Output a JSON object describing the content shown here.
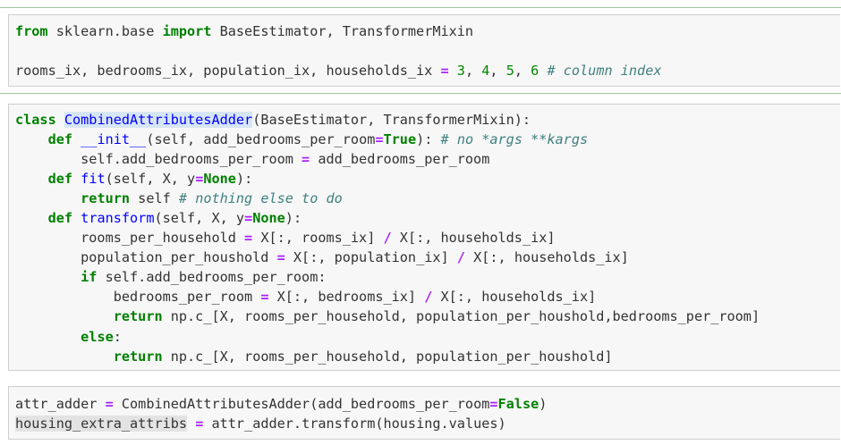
{
  "cells": [
    {
      "lines": [
        [
          {
            "t": "from",
            "c": "kw"
          },
          {
            "t": " sklearn.base "
          },
          {
            "t": "import",
            "c": "kw"
          },
          {
            "t": " BaseEstimator, TransformerMixin"
          }
        ],
        [],
        [
          {
            "t": "rooms_ix, bedrooms_ix, population_ix, households_ix "
          },
          {
            "t": "=",
            "c": "op"
          },
          {
            "t": " "
          },
          {
            "t": "3",
            "c": "num"
          },
          {
            "t": ", "
          },
          {
            "t": "4",
            "c": "num"
          },
          {
            "t": ", "
          },
          {
            "t": "5",
            "c": "num"
          },
          {
            "t": ", "
          },
          {
            "t": "6",
            "c": "num"
          },
          {
            "t": " "
          },
          {
            "t": "# column index",
            "c": "cm"
          }
        ]
      ]
    },
    {
      "lines": [
        [
          {
            "t": "class",
            "c": "kw"
          },
          {
            "t": " "
          },
          {
            "t": "CombinedAttributesAdder",
            "c": "cls"
          },
          {
            "t": "(BaseEstimator, TransformerMixin):"
          }
        ],
        [
          {
            "t": "    "
          },
          {
            "t": "def",
            "c": "kw"
          },
          {
            "t": " "
          },
          {
            "t": "__init__",
            "c": "fn"
          },
          {
            "t": "(self, add_bedrooms_per_room"
          },
          {
            "t": "=",
            "c": "op"
          },
          {
            "t": "True",
            "c": "kw"
          },
          {
            "t": "): "
          },
          {
            "t": "# no *args **kargs",
            "c": "cm"
          }
        ],
        [
          {
            "t": "        self.add_bedrooms_per_room "
          },
          {
            "t": "=",
            "c": "op"
          },
          {
            "t": " add_bedrooms_per_room"
          }
        ],
        [
          {
            "t": "    "
          },
          {
            "t": "def",
            "c": "kw"
          },
          {
            "t": " "
          },
          {
            "t": "fit",
            "c": "fn"
          },
          {
            "t": "(self, X, y"
          },
          {
            "t": "=",
            "c": "op"
          },
          {
            "t": "None",
            "c": "kw"
          },
          {
            "t": "):"
          }
        ],
        [
          {
            "t": "        "
          },
          {
            "t": "return",
            "c": "kw"
          },
          {
            "t": " self "
          },
          {
            "t": "# nothing else to do",
            "c": "cm"
          }
        ],
        [
          {
            "t": "    "
          },
          {
            "t": "def",
            "c": "kw"
          },
          {
            "t": " "
          },
          {
            "t": "transform",
            "c": "fn"
          },
          {
            "t": "(self, X, y"
          },
          {
            "t": "=",
            "c": "op"
          },
          {
            "t": "None",
            "c": "kw"
          },
          {
            "t": "):"
          }
        ],
        [
          {
            "t": "        rooms_per_household "
          },
          {
            "t": "=",
            "c": "op"
          },
          {
            "t": " X[:, rooms_ix] "
          },
          {
            "t": "/",
            "c": "op"
          },
          {
            "t": " X[:, households_ix]"
          }
        ],
        [
          {
            "t": "        population_per_houshold "
          },
          {
            "t": "=",
            "c": "op"
          },
          {
            "t": " X[:, population_ix] "
          },
          {
            "t": "/",
            "c": "op"
          },
          {
            "t": " X[:, households_ix]"
          }
        ],
        [
          {
            "t": "        "
          },
          {
            "t": "if",
            "c": "kw"
          },
          {
            "t": " self.add_bedrooms_per_room:"
          }
        ],
        [
          {
            "t": "            bedrooms_per_room "
          },
          {
            "t": "=",
            "c": "op"
          },
          {
            "t": " X[:, bedrooms_ix] "
          },
          {
            "t": "/",
            "c": "op"
          },
          {
            "t": " X[:, households_ix]"
          }
        ],
        [
          {
            "t": "            "
          },
          {
            "t": "return",
            "c": "kw"
          },
          {
            "t": " np.c_[X, rooms_per_household, population_per_houshold,bedrooms_per_room]"
          }
        ],
        [
          {
            "t": "        "
          },
          {
            "t": "else",
            "c": "kw"
          },
          {
            "t": ":"
          }
        ],
        [
          {
            "t": "            "
          },
          {
            "t": "return",
            "c": "kw"
          },
          {
            "t": " np.c_[X, rooms_per_household, population_per_houshold]"
          }
        ]
      ]
    },
    {
      "lines": [
        [
          {
            "t": "attr_adder "
          },
          {
            "t": "=",
            "c": "op"
          },
          {
            "t": " CombinedAttributesAdder(add_bedrooms_per_room"
          },
          {
            "t": "=",
            "c": "op"
          },
          {
            "t": "False",
            "c": "kw"
          },
          {
            "t": ")"
          }
        ],
        [
          {
            "t": "housing_extra_attribs",
            "c": "sel"
          },
          {
            "t": " "
          },
          {
            "t": "=",
            "c": "op"
          },
          {
            "t": " attr_adder.transform(housing.values)"
          }
        ]
      ]
    }
  ]
}
